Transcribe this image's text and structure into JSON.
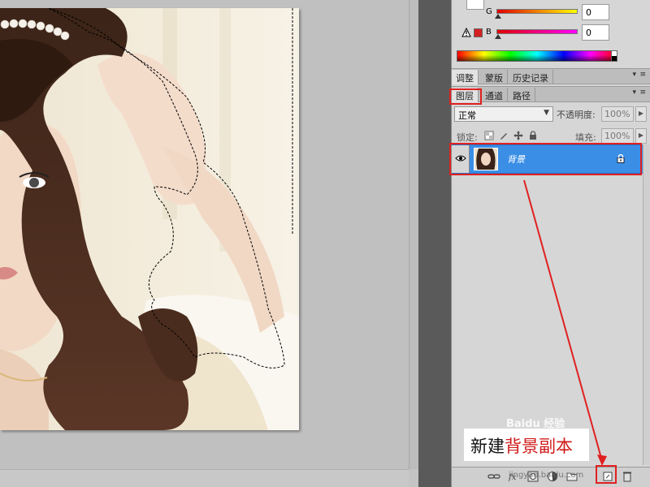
{
  "color_panel": {
    "g_label": "G",
    "g_value": "0",
    "b_label": "B",
    "b_value": "0",
    "fg_color": "#ffffff",
    "warning_color": "#d42020"
  },
  "adjust_tabs": [
    {
      "label": "调整"
    },
    {
      "label": "蒙版"
    },
    {
      "label": "历史记录"
    }
  ],
  "layer_tabs": [
    {
      "label": "图层"
    },
    {
      "label": "通道"
    },
    {
      "label": "路径"
    }
  ],
  "layers": {
    "blend_mode": "正常",
    "opacity_label": "不透明度:",
    "opacity_value": "100%",
    "lock_label": "锁定:",
    "fill_label": "填充:",
    "fill_value": "100%",
    "items": [
      {
        "name": "背景",
        "selected": true,
        "locked": true,
        "visible": true
      }
    ]
  },
  "toolbar_icons": [
    "link-layers-icon",
    "fx-icon",
    "mask-icon",
    "adjustment-icon",
    "folder-icon",
    "new-layer-icon",
    "trash-icon"
  ],
  "annotation": {
    "callout_prefix": "新建",
    "callout_highlight": "背景副本",
    "accent": "#e02020"
  },
  "watermark": {
    "text": "Baidu 经验",
    "url": "jingyan.baidu.com"
  }
}
